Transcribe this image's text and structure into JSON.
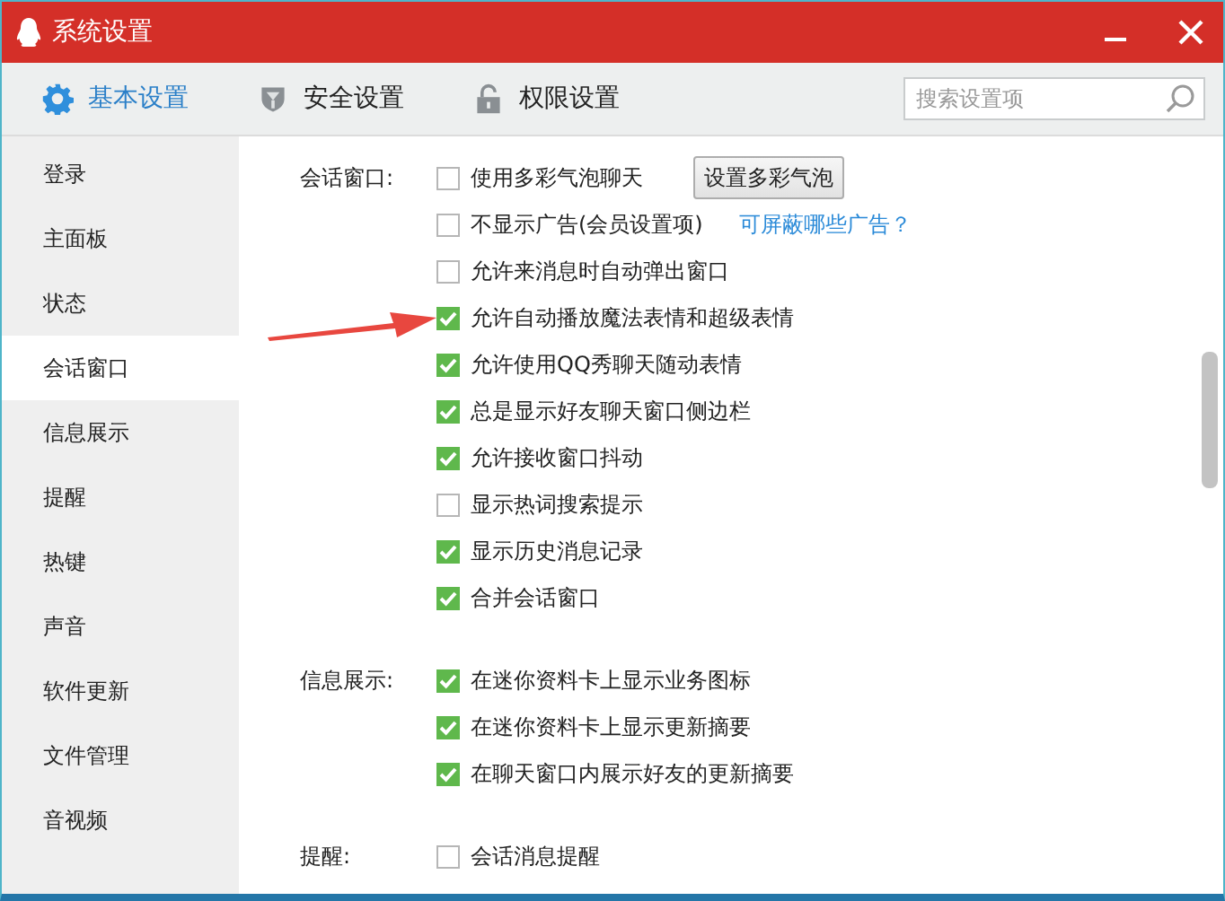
{
  "window": {
    "title": "系统设置"
  },
  "tabs": [
    {
      "label": "基本设置",
      "selected": true,
      "kind": "gear"
    },
    {
      "label": "安全设置",
      "selected": false,
      "kind": "shield"
    },
    {
      "label": "权限设置",
      "selected": false,
      "kind": "lock"
    }
  ],
  "search": {
    "placeholder": "搜索设置项"
  },
  "sidebar": {
    "items": [
      {
        "label": "登录",
        "selected": false
      },
      {
        "label": "主面板",
        "selected": false
      },
      {
        "label": "状态",
        "selected": false
      },
      {
        "label": "会话窗口",
        "selected": true
      },
      {
        "label": "信息展示",
        "selected": false
      },
      {
        "label": "提醒",
        "selected": false
      },
      {
        "label": "热键",
        "selected": false
      },
      {
        "label": "声音",
        "selected": false
      },
      {
        "label": "软件更新",
        "selected": false
      },
      {
        "label": "文件管理",
        "selected": false
      },
      {
        "label": "音视频",
        "selected": false
      }
    ]
  },
  "sections": [
    {
      "label": "会话窗口:",
      "options": [
        {
          "label": "使用多彩气泡聊天",
          "checked": false,
          "button": "设置多彩气泡"
        },
        {
          "label": "不显示广告(会员设置项)",
          "checked": false,
          "link": "可屏蔽哪些广告？"
        },
        {
          "label": "允许来消息时自动弹出窗口",
          "checked": false
        },
        {
          "label": "允许自动播放魔法表情和超级表情",
          "checked": true
        },
        {
          "label": "允许使用QQ秀聊天随动表情",
          "checked": true
        },
        {
          "label": "总是显示好友聊天窗口侧边栏",
          "checked": true
        },
        {
          "label": "允许接收窗口抖动",
          "checked": true
        },
        {
          "label": "显示热词搜索提示",
          "checked": false
        },
        {
          "label": "显示历史消息记录",
          "checked": true
        },
        {
          "label": "合并会话窗口",
          "checked": true
        }
      ]
    },
    {
      "label": "信息展示:",
      "options": [
        {
          "label": "在迷你资料卡上显示业务图标",
          "checked": true
        },
        {
          "label": "在迷你资料卡上显示更新摘要",
          "checked": true
        },
        {
          "label": "在聊天窗口内展示好友的更新摘要",
          "checked": true
        }
      ]
    },
    {
      "label": "提醒:",
      "options": [
        {
          "label": "会话消息提醒",
          "checked": false
        }
      ]
    }
  ]
}
